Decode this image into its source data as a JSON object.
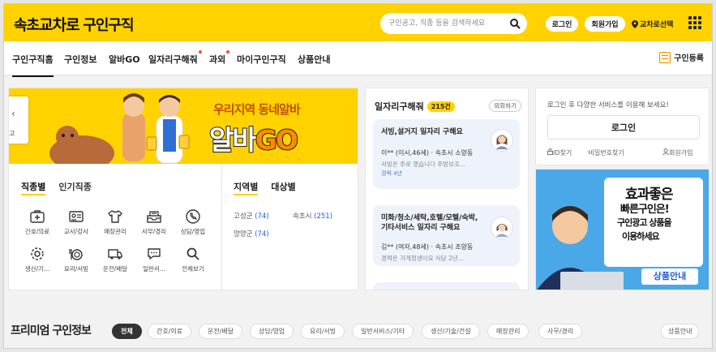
{
  "header": {
    "logo_pre": "속초",
    "logo_brand": "교차로",
    "logo_post": "구인구직",
    "search_placeholder": "구인공고, 직종 등을 검색하세요",
    "login": "로그인",
    "join": "회원가입",
    "region": "교차로선택"
  },
  "nav": {
    "items": [
      "구인구직홈",
      "구인정보",
      "알바GO",
      "일자리구해줘",
      "과외",
      "마이구인구직",
      "상품안내"
    ],
    "register": "구인등록"
  },
  "banner": {
    "tab_label": "고",
    "tagline": "우리지역 동네알바",
    "big_a": "알바",
    "big_b": "GO"
  },
  "categories": {
    "tab_job": "직종별",
    "tab_popular": "인기직종",
    "items": [
      "간호/의료",
      "교사/강사",
      "매장관리",
      "사무/경리",
      "상담/영업",
      "생산/기...",
      "요리/서빙",
      "운전/배달",
      "일반서...",
      "전체보기"
    ]
  },
  "locations": {
    "tab_region": "지역별",
    "tab_target": "대상별",
    "items": [
      {
        "name": "고성군",
        "count": "(74)"
      },
      {
        "name": "속초시",
        "count": "(251)"
      },
      {
        "name": "양양군",
        "count": "(74)"
      }
    ]
  },
  "helper": {
    "title": "일자리구해줘",
    "count": "215건",
    "close": "외회하기",
    "cards": [
      {
        "title": "서빙,설거지 일자리 구해요",
        "meta": "이** (이시,46세) · 속초시 소양동",
        "desc": "서빙은 주로 했습니다 주방보조...",
        "extra": "경력 4년"
      },
      {
        "title": "미화/청소/세탁,호텔/모텔/숙박,기타서비스 일자리 구해요",
        "meta": "김** (여자,48세) · 속초시 조양동",
        "desc": "경력은 가게정생이요 식당 2년...",
        "extra": ""
      }
    ]
  },
  "login_box": {
    "message": "로그인 후 다양한 서비스를 이용해 보세요!",
    "button": "로그인",
    "find_id": "ID찾기",
    "find_pw": "비밀번호찾기",
    "join": "회원가입"
  },
  "ad": {
    "line1": "효과좋은",
    "line2": "빠른구인은!",
    "line3": "구인광고 상품을",
    "line4": "이용하세요",
    "button": "상품안내"
  },
  "premium": {
    "title": "프리미엄 구인정보",
    "chips": [
      "전체",
      "간호/의료",
      "운전/배달",
      "상담/영업",
      "요리/서빙",
      "일반서비스/기타",
      "생산/기술/건설",
      "매장관리",
      "사무/경리"
    ],
    "more": "상품안내"
  },
  "colors": {
    "brand_yellow": "#ffd200",
    "accent_orange": "#ff8a00",
    "link_blue": "#1e5cd6"
  }
}
